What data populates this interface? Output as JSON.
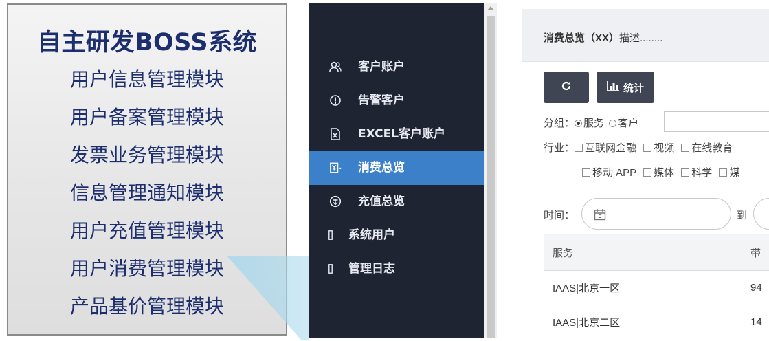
{
  "feature_panel": {
    "title": "自主研发BOSS系统",
    "items": [
      "用户信息管理模块",
      "用户备案管理模块",
      "发票业务管理模块",
      "信息管理通知模块",
      "用户充值管理模块",
      "用户消费管理模块",
      "产品基价管理模块"
    ],
    "highlighted_item": "用户消费管理模块"
  },
  "sidebar": {
    "items": [
      {
        "label": "客户账户",
        "icon": "users-icon"
      },
      {
        "label": "告警客户",
        "icon": "alert-icon"
      },
      {
        "label": "EXCEL客户账户",
        "icon": "excel-file-icon"
      },
      {
        "label": "消费总览",
        "icon": "receipt-icon",
        "active": true
      },
      {
        "label": "充值总览",
        "icon": "recharge-icon"
      },
      {
        "label": "系统用户",
        "icon": "placeholder-icon"
      },
      {
        "label": "管理日志",
        "icon": "placeholder-icon"
      }
    ]
  },
  "content": {
    "header_title": "消费总览（XX）",
    "header_desc": "描述........",
    "toolbar": {
      "refresh_icon": "refresh-icon",
      "stats_label": "统计",
      "stats_icon": "bar-chart-icon"
    },
    "group": {
      "label": "分组：",
      "options": [
        "服务",
        "客户"
      ],
      "selected": "服务",
      "input_value": ""
    },
    "industry": {
      "label": "行业：",
      "row1": [
        "互联网金融",
        "视频",
        "在线教育"
      ],
      "row2": [
        "移动 APP",
        "媒体",
        "科学",
        "媒"
      ]
    },
    "time": {
      "label": "时间：",
      "to_label": "到",
      "calendar_icon": "calendar-icon"
    },
    "table": {
      "headers": [
        "服务",
        "带"
      ],
      "rows": [
        [
          "IAAS|北京一区",
          "94"
        ],
        [
          "IAAS|北京二区",
          "14"
        ]
      ]
    }
  },
  "colors": {
    "sidebar_bg": "#1f2433",
    "active_item": "#3c80c9",
    "title_text": "#1c2e6e",
    "button_bg": "#3f4553"
  }
}
